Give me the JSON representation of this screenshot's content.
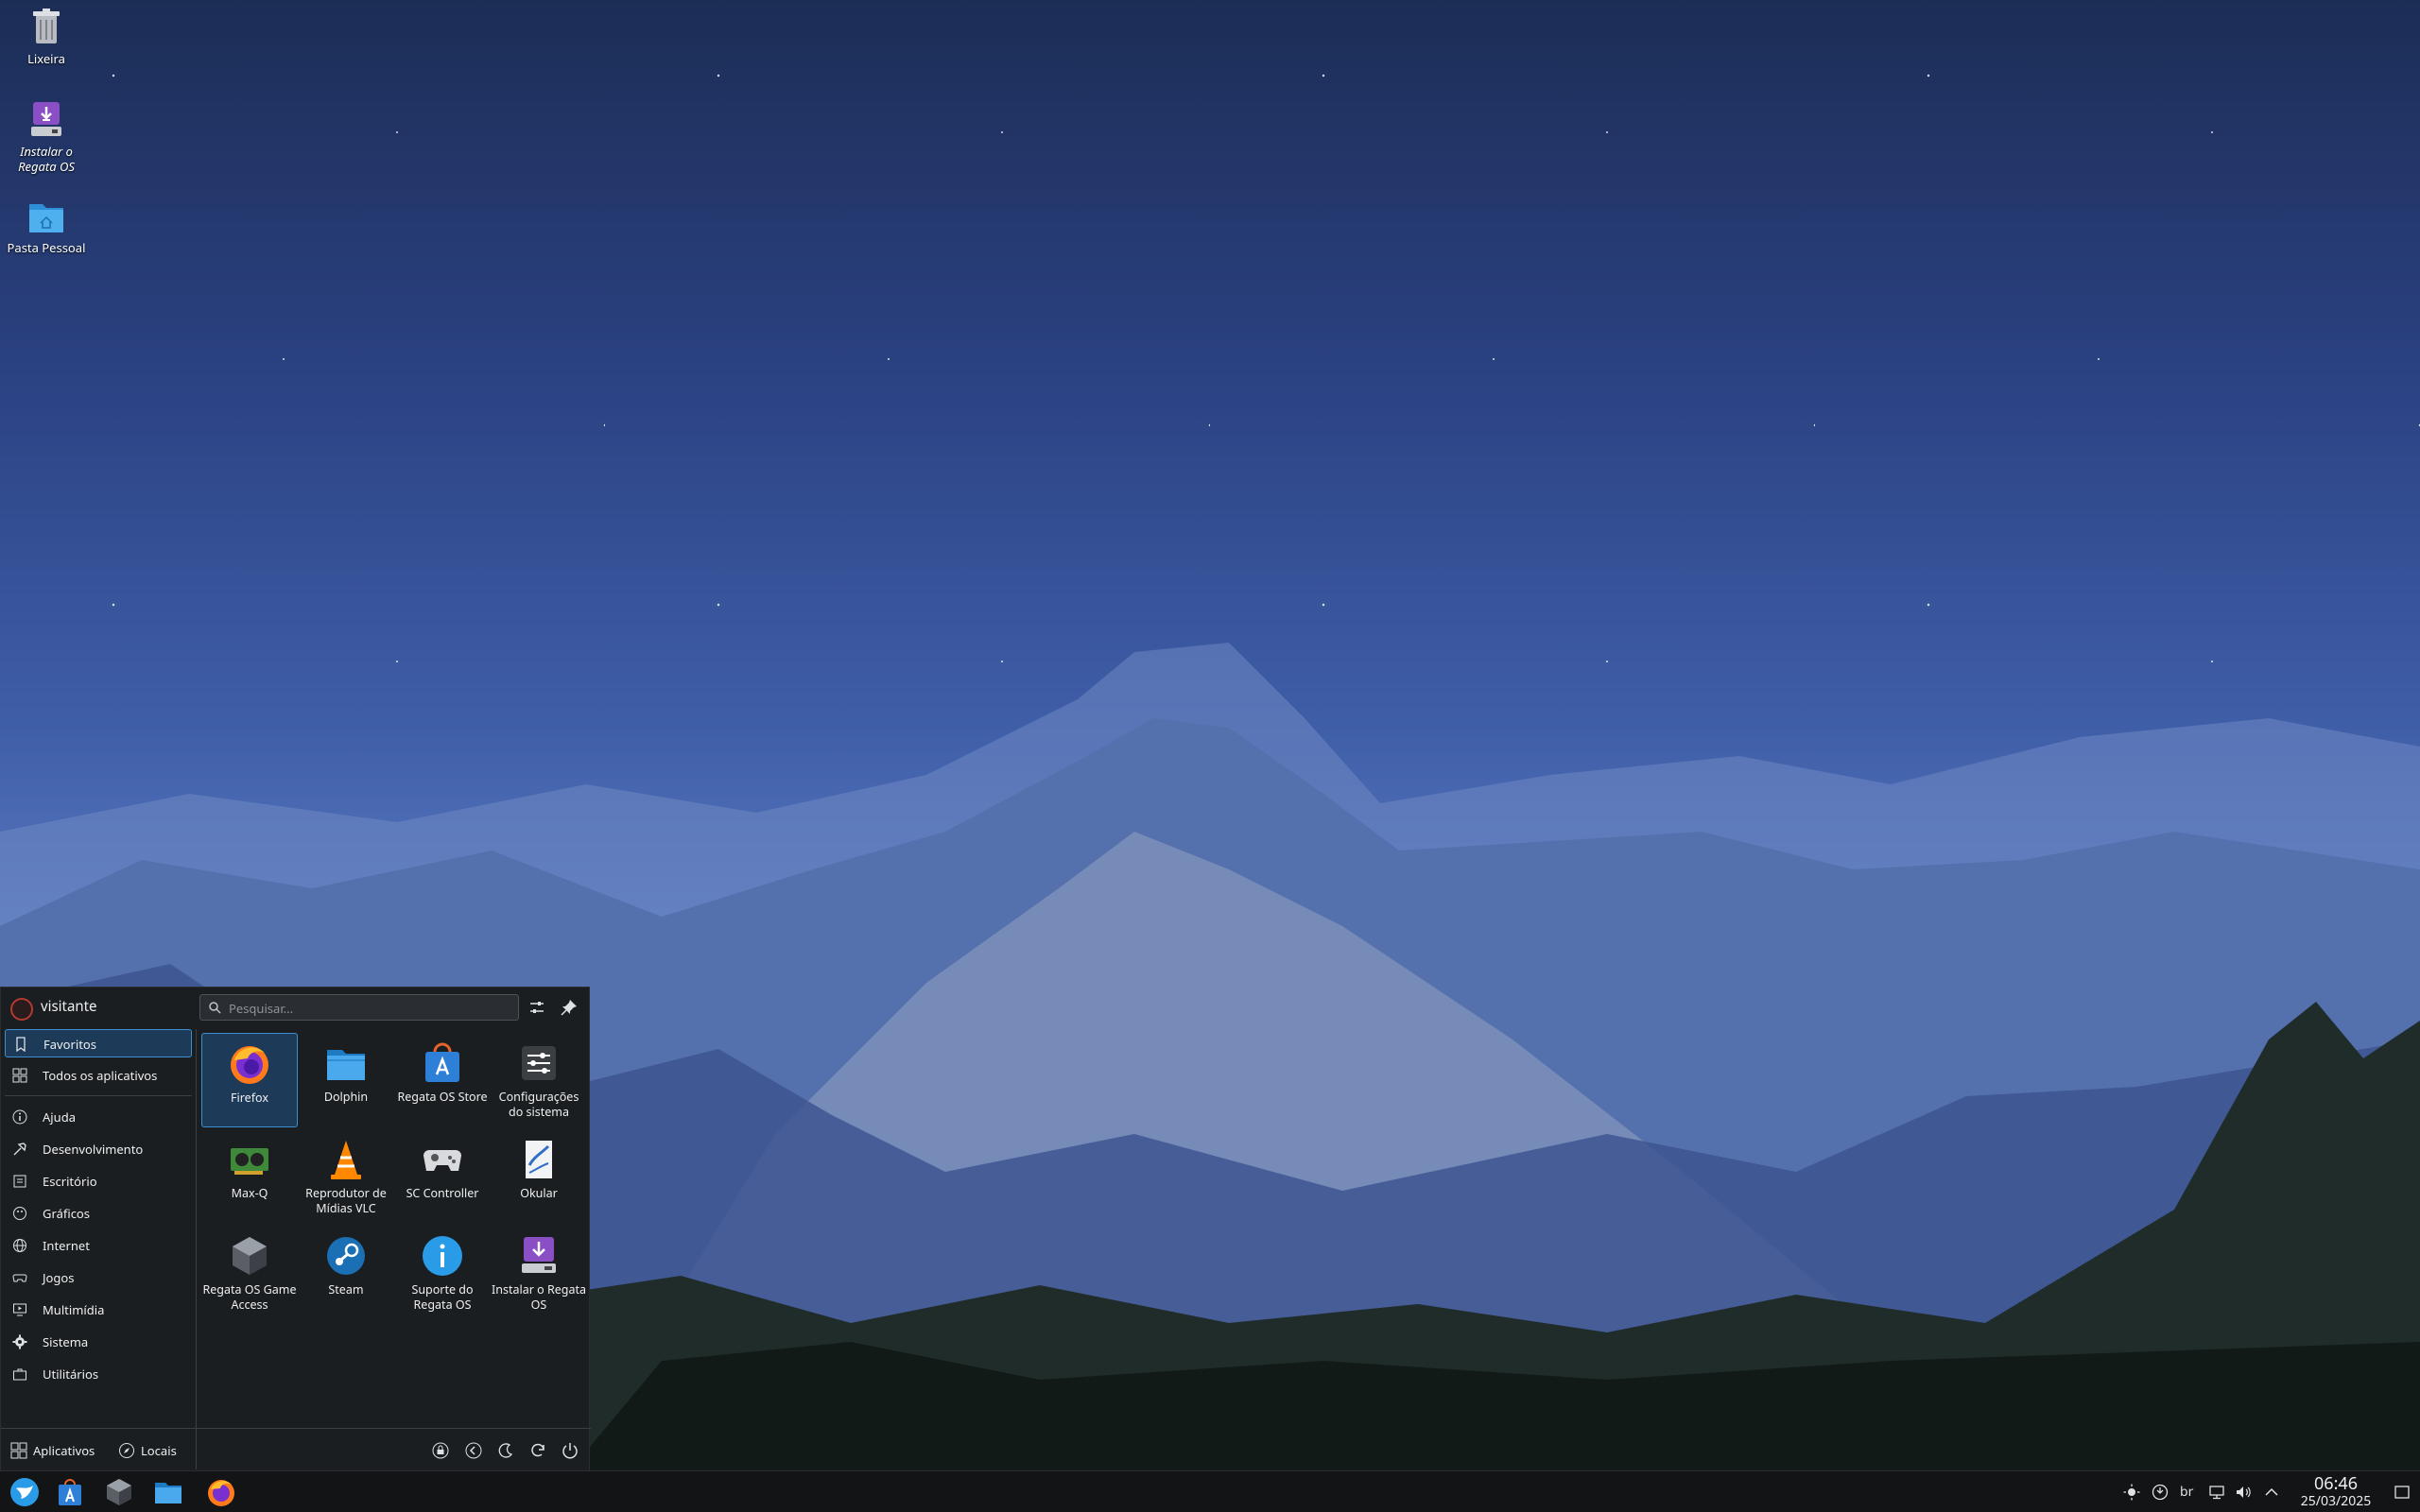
{
  "desktop": {
    "icons": [
      {
        "label": "Lixeira"
      },
      {
        "label": "Instalar o Regata OS"
      },
      {
        "label": "Pasta Pessoal"
      }
    ]
  },
  "launcher": {
    "user": "visitante",
    "search_placeholder": "Pesquisar...",
    "sidebar": [
      {
        "label": "Favoritos",
        "icon": "bookmark-icon"
      },
      {
        "label": "Todos os aplicativos",
        "icon": "grid-icon"
      },
      {
        "label": "Ajuda",
        "icon": "info-icon"
      },
      {
        "label": "Desenvolvimento",
        "icon": "hammer-icon"
      },
      {
        "label": "Escritório",
        "icon": "document-icon"
      },
      {
        "label": "Gráficos",
        "icon": "palette-icon"
      },
      {
        "label": "Internet",
        "icon": "globe-icon"
      },
      {
        "label": "Jogos",
        "icon": "gamepad-icon"
      },
      {
        "label": "Multimídia",
        "icon": "monitor-icon"
      },
      {
        "label": "Sistema",
        "icon": "gear-icon"
      },
      {
        "label": "Utilitários",
        "icon": "briefcase-icon"
      }
    ],
    "apps": [
      {
        "label": "Firefox"
      },
      {
        "label": "Dolphin"
      },
      {
        "label": "Regata OS Store"
      },
      {
        "label": "Configurações do sistema"
      },
      {
        "label": "Max-Q"
      },
      {
        "label": "Reprodutor de Mídias VLC"
      },
      {
        "label": "SC Controller"
      },
      {
        "label": "Okular"
      },
      {
        "label": "Regata OS Game Access"
      },
      {
        "label": "Steam"
      },
      {
        "label": "Suporte do Regata OS"
      },
      {
        "label": "Instalar o Regata OS"
      }
    ],
    "footer": {
      "apps_tab": "Aplicativos",
      "places_tab": "Locais"
    }
  },
  "taskbar": {
    "keyboard_layout": "br",
    "time": "06:46",
    "date": "25/03/2025"
  }
}
